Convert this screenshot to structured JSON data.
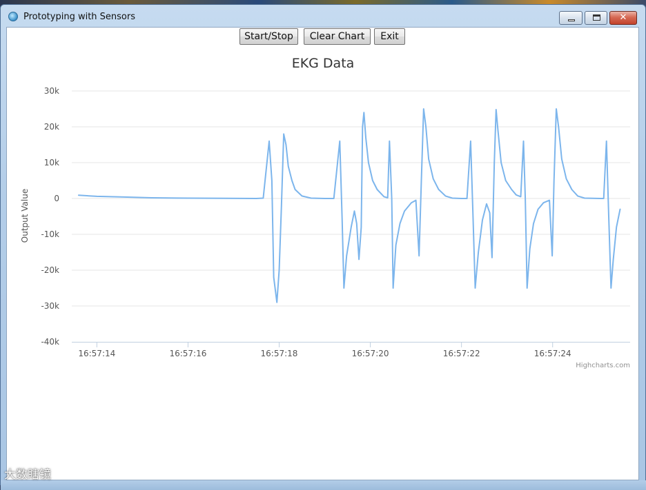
{
  "window": {
    "title": "Prototyping with Sensors",
    "icon": "app-globe-icon",
    "controls": [
      "minimize-icon",
      "maximize-icon",
      "close-icon"
    ],
    "close_glyph": "✕"
  },
  "toolbar": {
    "start_stop_label": "Start/Stop",
    "clear_chart_label": "Clear Chart",
    "exit_label": "Exit"
  },
  "chart_data": {
    "type": "line",
    "title": "EKG Data",
    "xlabel": "",
    "ylabel": "Output Value",
    "ylim": [
      -40000,
      30000
    ],
    "yticks": [
      {
        "value": 30000,
        "label": "30k"
      },
      {
        "value": 20000,
        "label": "20k"
      },
      {
        "value": 10000,
        "label": "10k"
      },
      {
        "value": 0,
        "label": "0"
      },
      {
        "value": -10000,
        "label": "-10k"
      },
      {
        "value": -20000,
        "label": "-20k"
      },
      {
        "value": -30000,
        "label": "-30k"
      },
      {
        "value": -40000,
        "label": "-40k"
      }
    ],
    "xlim": [
      13.45,
      25.7
    ],
    "xticks": [
      {
        "value": 14,
        "label": "16:57:14"
      },
      {
        "value": 16,
        "label": "16:57:16"
      },
      {
        "value": 18,
        "label": "16:57:18"
      },
      {
        "value": 20,
        "label": "16:57:20"
      },
      {
        "value": 22,
        "label": "16:57:22"
      },
      {
        "value": 24,
        "label": "16:57:24"
      }
    ],
    "grid": true,
    "credit": "Highcharts.com",
    "series": [
      {
        "color": "#7cb5ec",
        "points": [
          [
            13.6,
            900
          ],
          [
            14.0,
            600
          ],
          [
            14.6,
            400
          ],
          [
            15.2,
            200
          ],
          [
            16.0,
            100
          ],
          [
            16.8,
            50
          ],
          [
            17.5,
            0
          ],
          [
            17.65,
            100
          ],
          [
            17.78,
            16000
          ],
          [
            17.84,
            5000
          ],
          [
            17.88,
            -22000
          ],
          [
            17.95,
            -29000
          ],
          [
            18.0,
            -20000
          ],
          [
            18.05,
            -2000
          ],
          [
            18.1,
            18000
          ],
          [
            18.15,
            15000
          ],
          [
            18.2,
            9000
          ],
          [
            18.28,
            5000
          ],
          [
            18.35,
            2500
          ],
          [
            18.5,
            700
          ],
          [
            18.7,
            100
          ],
          [
            19.0,
            0
          ],
          [
            19.2,
            0
          ],
          [
            19.33,
            16000
          ],
          [
            19.38,
            -5000
          ],
          [
            19.42,
            -25000
          ],
          [
            19.48,
            -16000
          ],
          [
            19.58,
            -8000
          ],
          [
            19.65,
            -3500
          ],
          [
            19.7,
            -7000
          ],
          [
            19.75,
            -17000
          ],
          [
            19.8,
            -8000
          ],
          [
            19.83,
            20000
          ],
          [
            19.86,
            24000
          ],
          [
            19.9,
            17000
          ],
          [
            19.96,
            10000
          ],
          [
            20.05,
            5000
          ],
          [
            20.15,
            2500
          ],
          [
            20.3,
            500
          ],
          [
            20.38,
            200
          ],
          [
            20.42,
            16000
          ],
          [
            20.47,
            0
          ],
          [
            20.5,
            -25000
          ],
          [
            20.56,
            -13000
          ],
          [
            20.65,
            -7000
          ],
          [
            20.75,
            -3500
          ],
          [
            20.9,
            -1200
          ],
          [
            21.0,
            -500
          ],
          [
            21.07,
            -16000
          ],
          [
            21.12,
            5000
          ],
          [
            21.17,
            25000
          ],
          [
            21.22,
            20000
          ],
          [
            21.28,
            11000
          ],
          [
            21.38,
            5500
          ],
          [
            21.5,
            2500
          ],
          [
            21.65,
            700
          ],
          [
            21.8,
            100
          ],
          [
            22.0,
            0
          ],
          [
            22.12,
            0
          ],
          [
            22.2,
            16000
          ],
          [
            22.25,
            -4000
          ],
          [
            22.3,
            -25000
          ],
          [
            22.37,
            -15000
          ],
          [
            22.46,
            -6000
          ],
          [
            22.55,
            -1500
          ],
          [
            22.62,
            -4000
          ],
          [
            22.67,
            -16500
          ],
          [
            22.72,
            10000
          ],
          [
            22.76,
            24800
          ],
          [
            22.8,
            19000
          ],
          [
            22.87,
            10000
          ],
          [
            22.97,
            5000
          ],
          [
            23.1,
            2500
          ],
          [
            23.2,
            1000
          ],
          [
            23.3,
            500
          ],
          [
            23.36,
            16000
          ],
          [
            23.4,
            0
          ],
          [
            23.44,
            -25000
          ],
          [
            23.5,
            -14000
          ],
          [
            23.58,
            -7000
          ],
          [
            23.68,
            -3000
          ],
          [
            23.8,
            -1200
          ],
          [
            23.93,
            -500
          ],
          [
            23.99,
            -16000
          ],
          [
            24.03,
            5000
          ],
          [
            24.08,
            25000
          ],
          [
            24.13,
            20000
          ],
          [
            24.2,
            11000
          ],
          [
            24.3,
            5500
          ],
          [
            24.42,
            2500
          ],
          [
            24.55,
            700
          ],
          [
            24.7,
            100
          ],
          [
            25.05,
            0
          ],
          [
            25.12,
            0
          ],
          [
            25.18,
            16000
          ],
          [
            25.23,
            -5000
          ],
          [
            25.28,
            -25000
          ],
          [
            25.33,
            -17000
          ],
          [
            25.4,
            -8000
          ],
          [
            25.48,
            -3000
          ]
        ]
      }
    ]
  },
  "watermark": "大数瞎镜"
}
